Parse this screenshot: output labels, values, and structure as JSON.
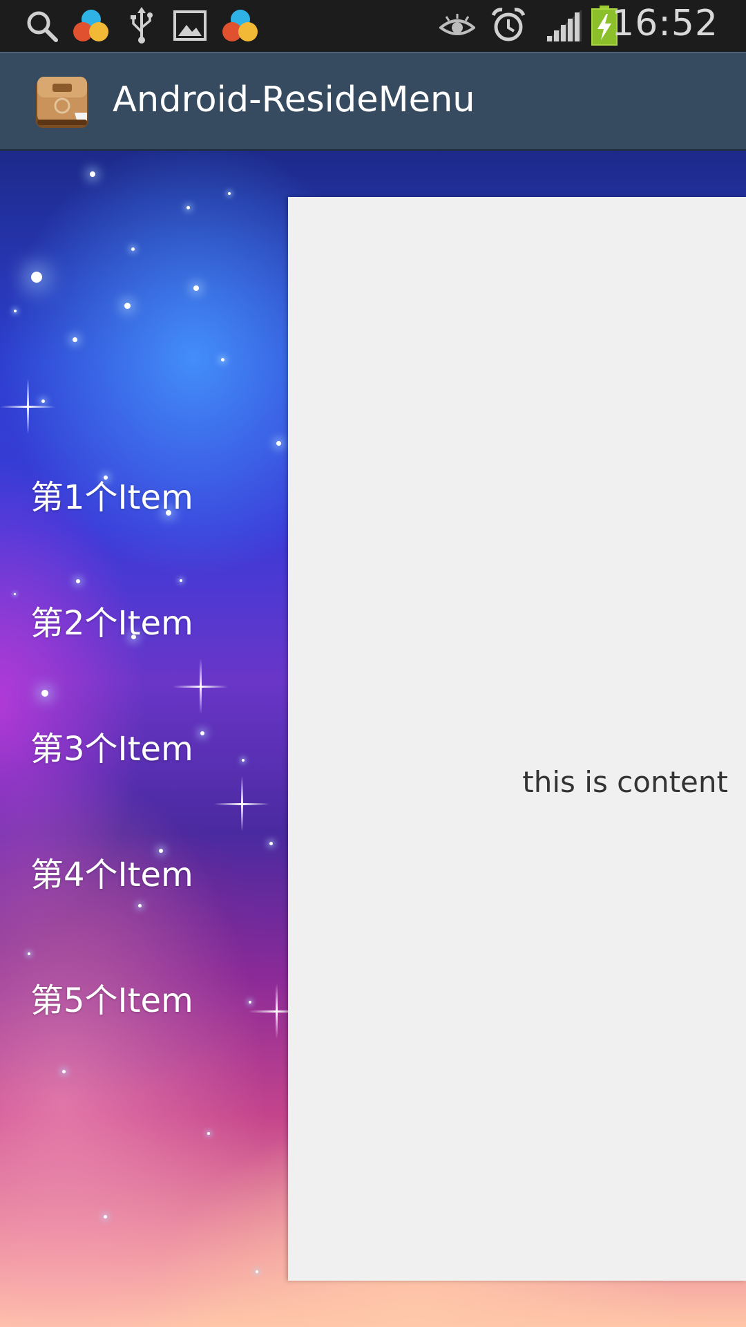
{
  "status_bar": {
    "time": "16:52",
    "icons": [
      "search-icon",
      "google-now-icon",
      "usb-icon",
      "image-icon",
      "google-now-icon",
      "eye-icon",
      "alarm-icon",
      "signal-icon",
      "battery-charging-icon"
    ]
  },
  "action_bar": {
    "title": "Android-ResideMenu",
    "icon": "app-briefcase-icon",
    "background_color": "#364b60"
  },
  "menu": {
    "items": [
      {
        "label": "第1个Item"
      },
      {
        "label": "第2个Item"
      },
      {
        "label": "第3个Item"
      },
      {
        "label": "第4个Item"
      },
      {
        "label": "第5个Item"
      }
    ]
  },
  "content": {
    "text": "this is content",
    "background_color": "#f0f0f0"
  }
}
